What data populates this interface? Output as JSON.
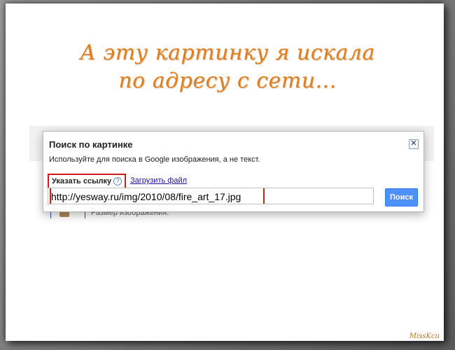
{
  "headline": {
    "line1": "А эту картинку я искала",
    "line2": "по адресу с сети..."
  },
  "background_strip": {
    "below_text": "Размер изображения."
  },
  "dialog": {
    "title": "Поиск по картинке",
    "subtitle": "Используйте для поиска в Google изображения, а не текст.",
    "tab_link_label": "Указать ссылку",
    "help_icon_glyph": "?",
    "tab_upload_label": "Загрузить файл",
    "url_value": "http://yesway.ru/img/2010/08/fire_art_17.jpg",
    "search_button": "Поиск",
    "close_glyph": "✕"
  },
  "signature": "MissKcu",
  "colors": {
    "headline": "#e07e1c",
    "highlight_border": "#d11a1a",
    "search_button": "#4d90fe",
    "link": "#1a0dab"
  }
}
